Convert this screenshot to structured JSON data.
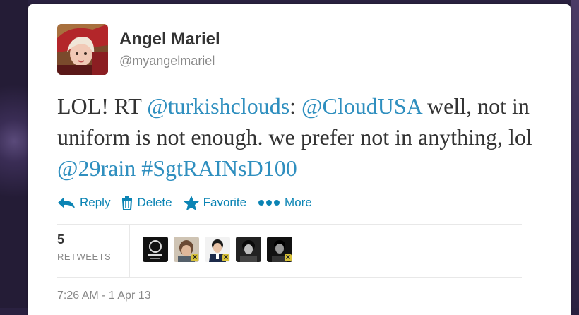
{
  "author": {
    "name": "Angel Mariel",
    "handle": "@myangelmariel",
    "avatar_icon": "profile-photo"
  },
  "tweet": {
    "segments": [
      {
        "text": "LOL! RT ",
        "type": "text"
      },
      {
        "text": "@turkishclouds",
        "type": "mention"
      },
      {
        "text": ": ",
        "type": "text"
      },
      {
        "text": "@CloudUSA",
        "type": "mention"
      },
      {
        "text": " well, not in uniform is not enough. we prefer not in anything, lol ",
        "type": "text"
      },
      {
        "text": "@29rain",
        "type": "mention"
      },
      {
        "text": " ",
        "type": "text"
      },
      {
        "text": "#SgtRAINsD100",
        "type": "hashtag"
      }
    ],
    "link_color": "#2f8fbf"
  },
  "actions": {
    "reply": "Reply",
    "delete": "Delete",
    "favorite": "Favorite",
    "more": "More",
    "color": "#0b84b4"
  },
  "stats": {
    "retweets_count": "5",
    "retweets_label": "RETWEETS",
    "retweeter_avatars": [
      "cloud-logo-avatar",
      "retweeter-avatar-2",
      "retweeter-avatar-3",
      "retweeter-avatar-4",
      "retweeter-avatar-5"
    ]
  },
  "timestamp": "7:26 AM - 1 Apr 13"
}
